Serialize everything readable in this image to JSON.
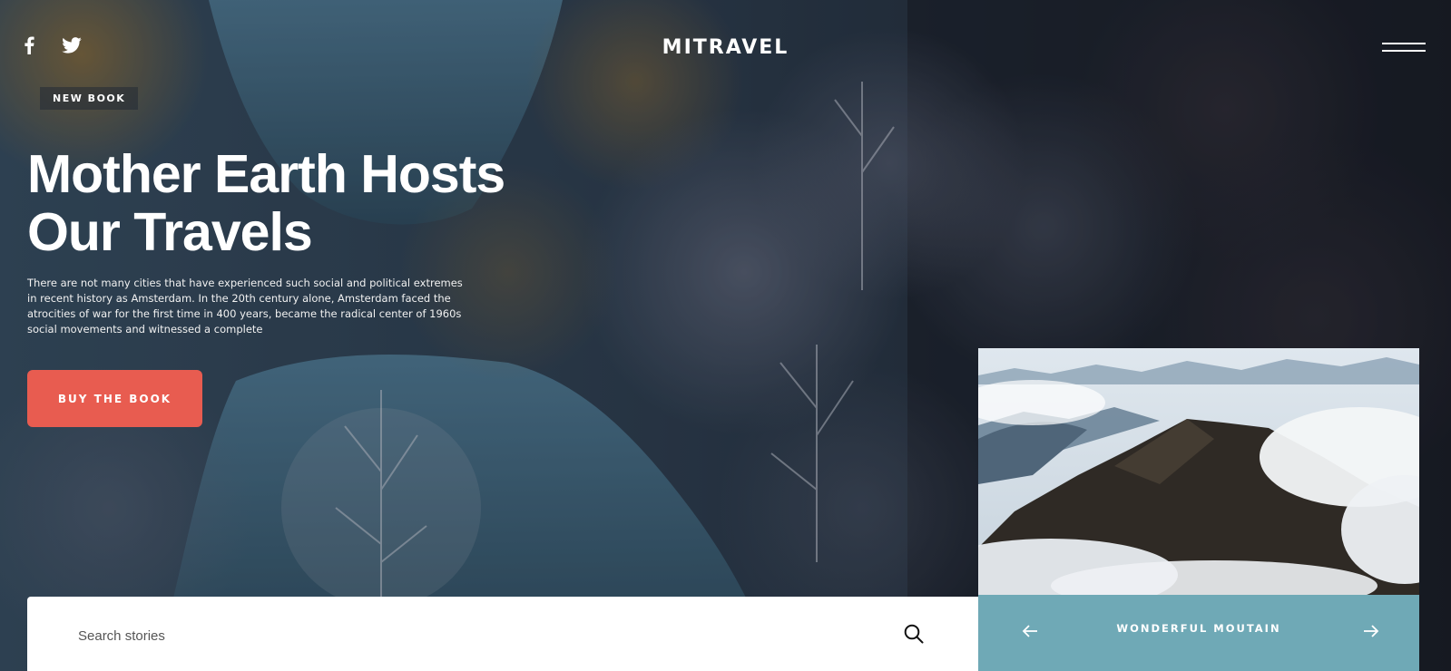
{
  "header": {
    "brand": "MITRAVEL",
    "social_icons": [
      "facebook-icon",
      "twitter-icon"
    ],
    "menu_icon": "hamburger-menu-icon"
  },
  "hero": {
    "badge": "NEW BOOK",
    "headline": "Mother Earth Hosts Our Travels",
    "intro": "There are not many cities that have experienced such social and political extremes in recent history as Amsterdam. In the 20th century alone, Amsterdam faced the atrocities of war for the first time in 400 years, became the radical center of 1960s social movements and witnessed a complete",
    "cta_label": "BUY THE BOOK"
  },
  "search": {
    "placeholder": "Search stories",
    "value": "",
    "icon": "search-icon"
  },
  "card": {
    "title": "WONDERFUL MOUTAIN",
    "prev_icon": "arrow-left-icon",
    "next_icon": "arrow-right-icon"
  },
  "colors": {
    "cta": "#e85c50",
    "card_footer": "#6fa9b6",
    "background": "#1e2631"
  }
}
